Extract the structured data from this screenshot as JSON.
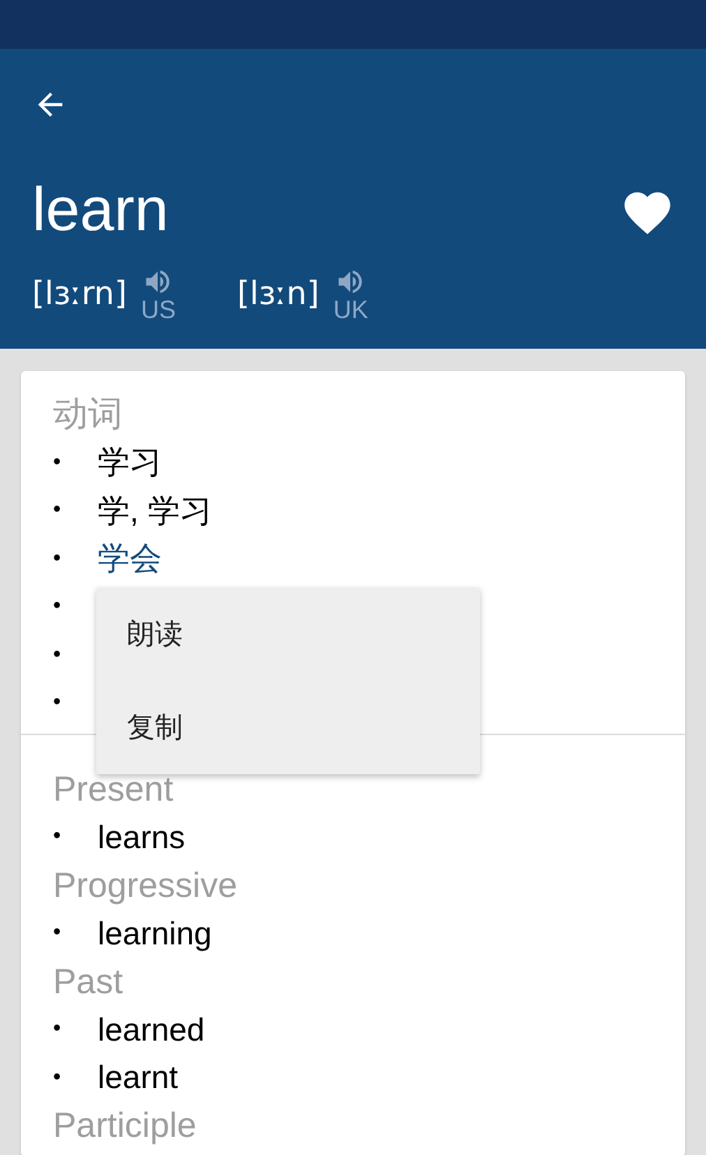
{
  "header": {
    "word": "learn",
    "pronunciations": [
      {
        "phonetic": "[lɜːrn]",
        "region": "US"
      },
      {
        "phonetic": "[lɜːn]",
        "region": "UK"
      }
    ]
  },
  "sections": [
    {
      "groups": [
        {
          "heading": "动词",
          "items": [
            {
              "bullet": "•",
              "text": "学习",
              "selected": false
            },
            {
              "bullet": "•",
              "text": "学, 学习",
              "selected": false
            },
            {
              "bullet": "•",
              "text": "学会",
              "selected": true
            },
            {
              "bullet": "•"
            },
            {
              "bullet": "•"
            },
            {
              "bullet": "•"
            }
          ]
        }
      ]
    },
    {
      "groups": [
        {
          "heading": "Present",
          "items": [
            {
              "bullet": "•",
              "text": "learns",
              "selected": false
            }
          ]
        },
        {
          "heading": "Progressive",
          "items": [
            {
              "bullet": "•",
              "text": "learning",
              "selected": false
            }
          ]
        },
        {
          "heading": "Past",
          "items": [
            {
              "bullet": "•",
              "text": "learned",
              "selected": false
            },
            {
              "bullet": "•",
              "text": "learnt",
              "selected": false
            }
          ]
        },
        {
          "heading": "Participle"
        }
      ]
    }
  ],
  "context_menu": {
    "items": [
      {
        "label": "朗读"
      },
      {
        "label": "复制"
      }
    ]
  }
}
